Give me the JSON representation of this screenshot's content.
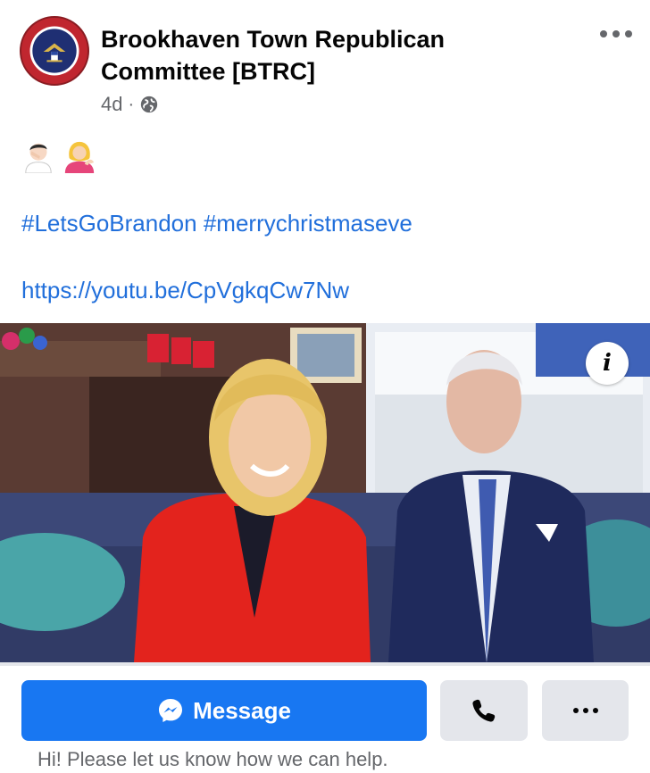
{
  "post": {
    "author": "Brookhaven Town Republican Committee [BTRC]",
    "time": "4d",
    "separator": "·",
    "audience_icon": "globe-icon",
    "more_icon": "more-horizontal-icon",
    "emojis": [
      "man-facepalming-emoji",
      "woman-tipping-hand-emoji"
    ],
    "hashtags": [
      "#LetsGoBrandon",
      "#merrychristmaseve"
    ],
    "link": "https://youtu.be/CpVgkqCw7Nw"
  },
  "video": {
    "info_label": "i"
  },
  "cta": {
    "message_label": "Message",
    "message_icon": "messenger-icon",
    "call_icon": "phone-icon",
    "more_icon": "more-horizontal-icon",
    "helper_text": "Hi! Please let us know how we can help."
  },
  "colors": {
    "link": "#216fdb",
    "primary_button": "#1877f2",
    "secondary_button": "#e4e6eb",
    "meta_text": "#65676b"
  }
}
